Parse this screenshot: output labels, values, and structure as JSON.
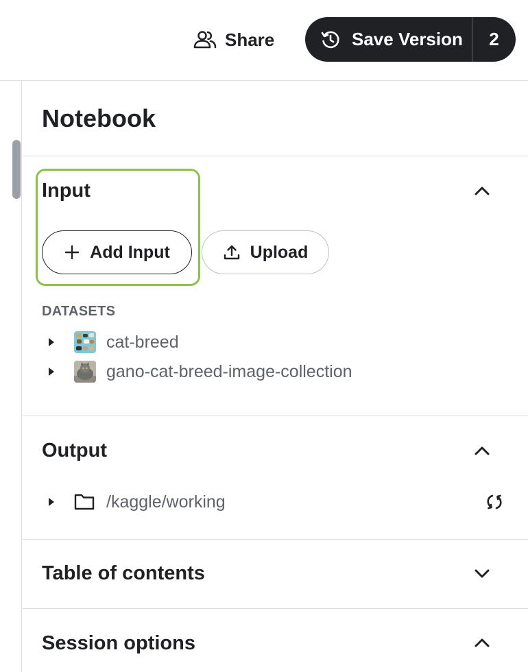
{
  "header": {
    "share_label": "Share",
    "save_version_label": "Save Version",
    "save_version_count": "2"
  },
  "panel": {
    "title": "Notebook",
    "input": {
      "title": "Input",
      "expanded": true,
      "add_input_label": "Add Input",
      "upload_label": "Upload",
      "datasets_heading": "DATASETS",
      "datasets": [
        {
          "name": "cat-breed"
        },
        {
          "name": "gano-cat-breed-image-collection"
        }
      ]
    },
    "output": {
      "title": "Output",
      "expanded": true,
      "path": "/kaggle/working"
    },
    "toc": {
      "title": "Table of contents",
      "expanded": false
    },
    "session": {
      "title": "Session options",
      "expanded": true
    }
  },
  "colors": {
    "save_button_bg": "#202124",
    "highlight_border": "#8bc34a",
    "muted_text": "#5f6368",
    "divider": "#dadce0"
  },
  "icons": {
    "share": "people-icon",
    "save_version": "history-icon",
    "add_input": "plus-icon",
    "upload": "upload-icon",
    "output_folder": "folder-icon",
    "output_refresh": "sync-icon"
  }
}
